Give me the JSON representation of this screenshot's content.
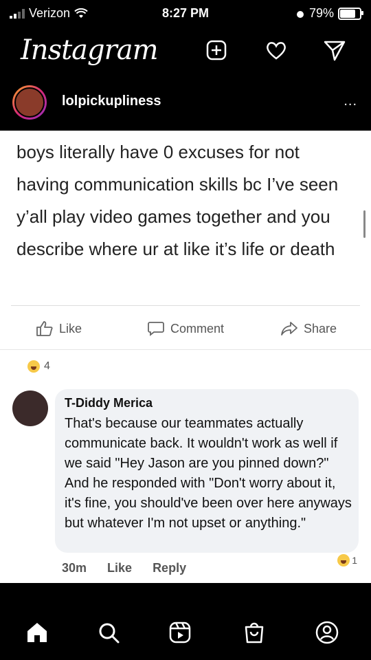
{
  "status_bar": {
    "carrier": "Verizon",
    "time": "8:27 PM",
    "battery": "79%",
    "battery_level": 0.79
  },
  "app": {
    "title": "Instagram"
  },
  "post": {
    "username": "lolpickupliness",
    "more": "..."
  },
  "facebook_post": {
    "text": "boys literally have 0 excuses for not having communication skills bc I’ve seen y’all play video games together and you describe where ur at like it’s life or death",
    "actions": {
      "like": "Like",
      "comment": "Comment",
      "share": "Share"
    },
    "reaction_count": "4"
  },
  "comment": {
    "author": "T-Diddy Merica",
    "text": "That's because our teammates actually communicate back. It wouldn't work as well if we said \"Hey Jason are you pinned down?\" And he responded with \"Don't worry about it, it's fine, you should've been over here anyways but whatever I'm not upset or anything.\"",
    "time": "30m",
    "like": "Like",
    "reply": "Reply",
    "reaction_count": "1"
  },
  "icons": [
    "add-post-icon",
    "heart-icon",
    "direct-message-icon",
    "home-icon",
    "search-icon",
    "reels-icon",
    "shop-icon",
    "profile-icon"
  ]
}
